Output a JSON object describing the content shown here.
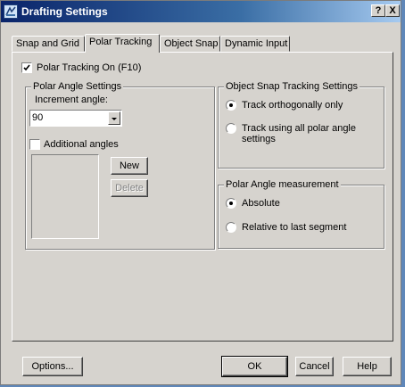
{
  "window": {
    "title": "Drafting Settings",
    "help_label": "?",
    "close_label": "X"
  },
  "tabs": [
    {
      "label": "Snap and Grid"
    },
    {
      "label": "Polar Tracking"
    },
    {
      "label": "Object Snap"
    },
    {
      "label": "Dynamic Input"
    }
  ],
  "polar_tracking_on": {
    "label": "Polar Tracking On (F10)",
    "checked": true
  },
  "polar_angle_settings": {
    "title": "Polar Angle Settings",
    "increment_label": "Increment angle:",
    "increment_value": "90",
    "additional_angles_label": "Additional angles",
    "new_label": "New",
    "delete_label": "Delete"
  },
  "object_snap_tracking": {
    "title": "Object Snap Tracking Settings",
    "option1": "Track orthogonally only",
    "option2_line1": "Track using all polar angle",
    "option2_line2": "settings"
  },
  "polar_angle_measurement": {
    "title": "Polar Angle measurement",
    "option1": "Absolute",
    "option2": "Relative to last segment"
  },
  "footer": {
    "options_label": "Options...",
    "ok_label": "OK",
    "cancel_label": "Cancel",
    "help_label": "Help"
  }
}
